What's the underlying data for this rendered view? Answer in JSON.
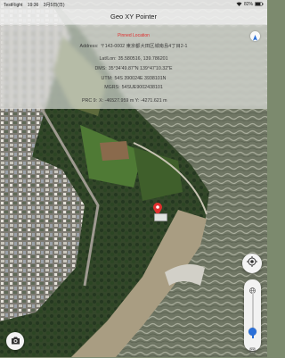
{
  "status_bar": {
    "carrier": "TestFlight",
    "time": "19:36",
    "date": "3月5日(日)",
    "battery": "82%"
  },
  "nav": {
    "title": "Geo XY Pointer"
  },
  "info": {
    "pinned_label": "Pinned Location",
    "address_label": "Address:",
    "address_value": "〒143-0002 東京都大田区城南島4丁目2-1",
    "latlon_label": "Lat/Lon:",
    "latlon_value": "35.580516, 139.786201",
    "dms_label": "DMS:",
    "dms_value": "35°34'49.87\"N 139°47'10.32\"E",
    "utm_label": "UTM:",
    "utm_value": "54S 390024E 3938101N",
    "mgrs_label": "MGRS:",
    "mgrs_value": "54SUE9002438101",
    "prc_label": "PRC 9:",
    "prc_value": "X: -46527.959 m  Y: -4271.621 m"
  },
  "icons": {
    "compass": "compass-arrow-icon",
    "pin": "map-pin-icon",
    "locate": "crosshair-locate-icon",
    "camera": "camera-icon",
    "slider_top": "globe-icon",
    "slider_bottom": "building-icon"
  },
  "zoom_slider": {
    "level": 0.15
  },
  "colors": {
    "accent": "#2a6fd8",
    "pin": "#e0302f"
  }
}
